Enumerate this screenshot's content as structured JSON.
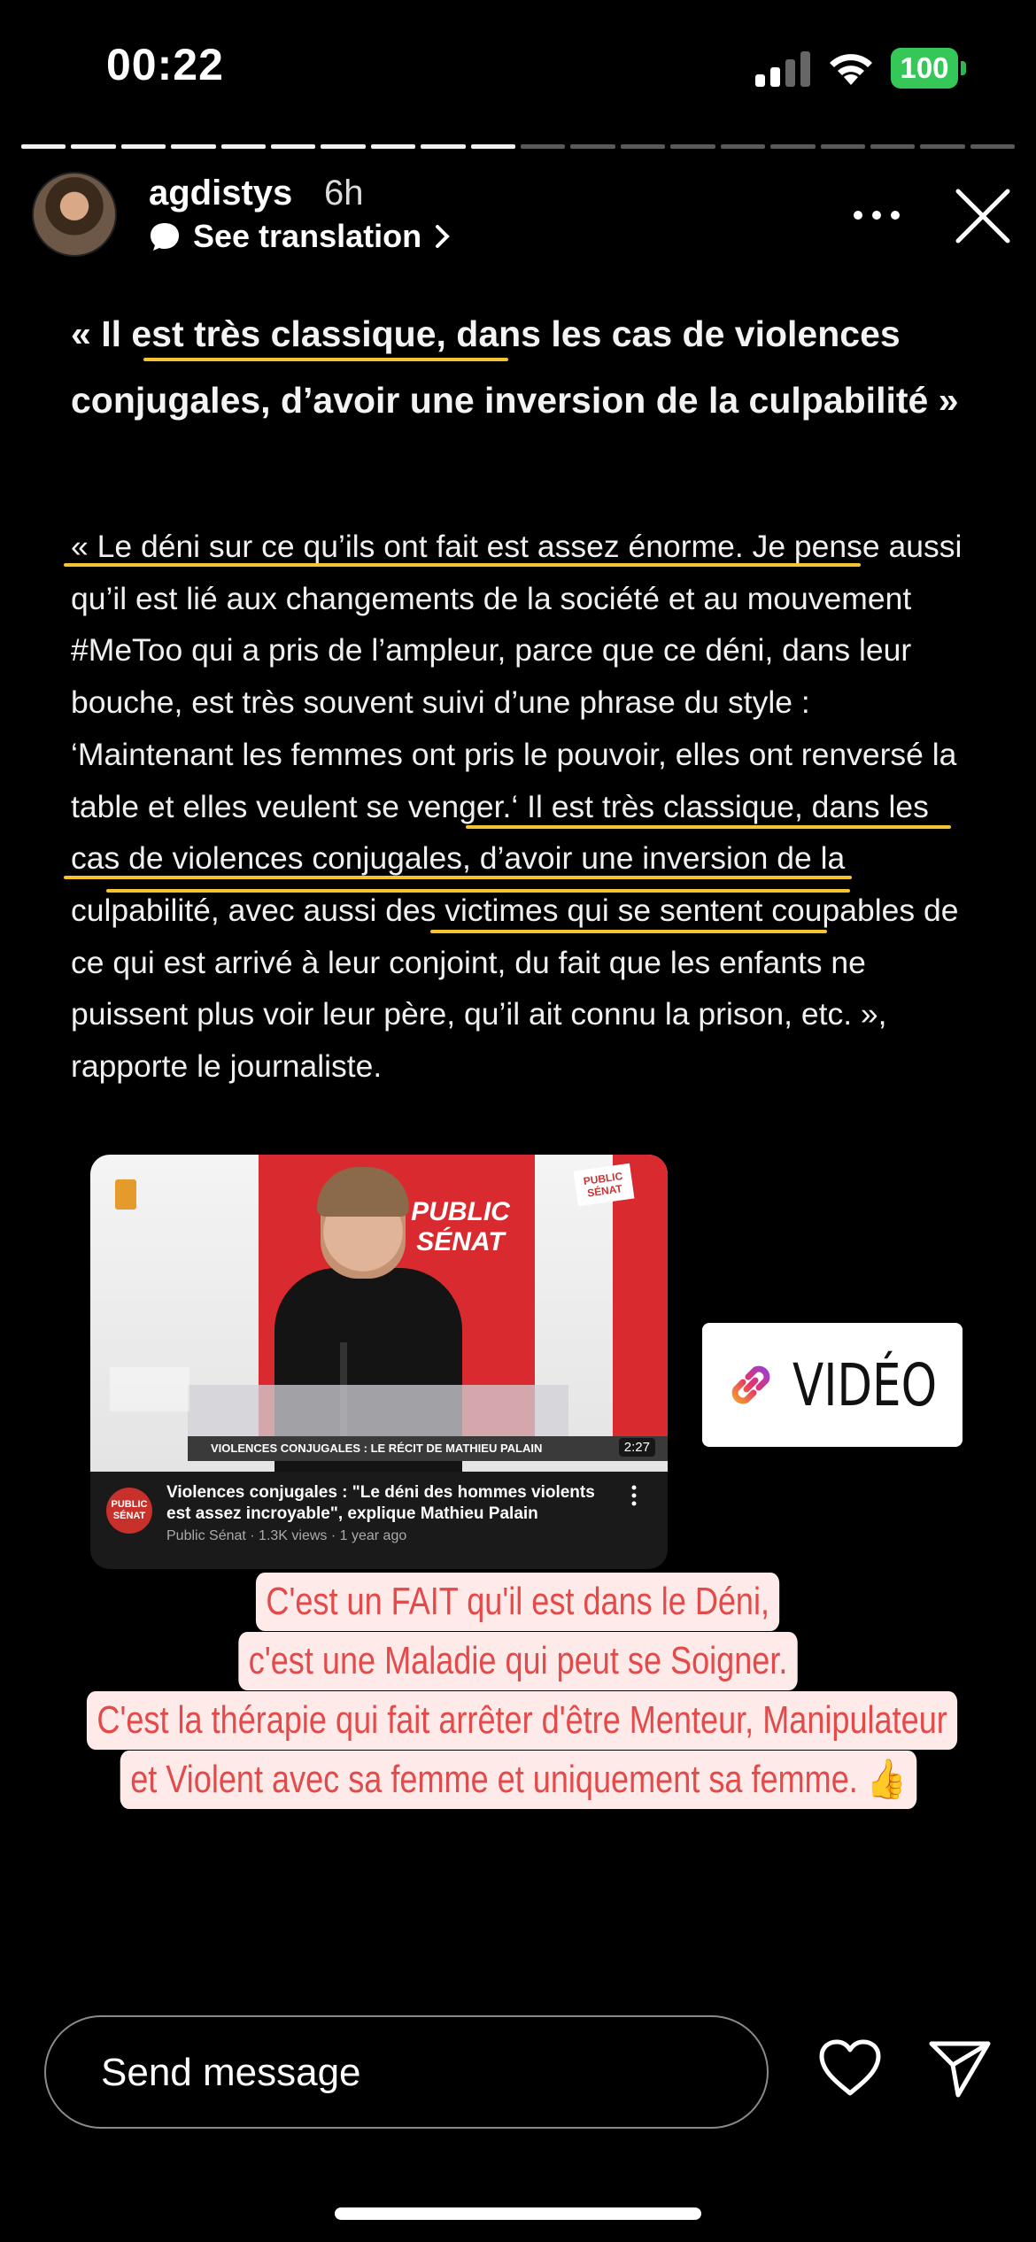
{
  "status_bar": {
    "time": "00:22",
    "battery": "100"
  },
  "progress": {
    "segments_total": 20,
    "segments_done": 10
  },
  "story_header": {
    "username": "agdistys",
    "time_ago": "6h",
    "translate_label": "See translation"
  },
  "article": {
    "headline": "« Il est très classique, dans les cas de violences conjugales, d’avoir une inversion de la culpabilité »",
    "body": "« Le déni sur ce qu’ils ont fait est assez énorme. Je pense aussi qu’il est lié aux changements de la société et au mouvement #MeToo qui a pris de l’ampleur, parce que ce déni, dans leur bouche, est très souvent suivi d’une phrase du style : ‘Maintenant les femmes ont pris le pouvoir, elles ont renversé la table et elles veulent se venger.‘ Il est très classique, dans les cas de violences conjugales, d’avoir une inversion de la culpabilité, avec aussi des victimes qui se sentent coupables de ce qui est arrivé à leur conjoint, du fait que les enfants ne puissent plus voir leur père, qu’il ait connu la prison, etc. », rapporte le journaliste."
  },
  "video_card": {
    "logo_text": "PUBLIC SÉNAT",
    "lower_third": "VIOLENCES CONJUGALES : LE RÉCIT DE MATHIEU PALAIN",
    "duration": "2:27",
    "title": "Violences conjugales : \"Le déni des hommes violents est assez incroyable\", explique Mathieu Palain",
    "meta": "Public Sénat · 1.3K views · 1 year ago",
    "channel_avatar_text": "PUBLIC SÉNAT"
  },
  "link_sticker": {
    "label": "VIDÉO"
  },
  "caption": {
    "lines": [
      "C'est un FAIT qu'il est dans le Déni,",
      "c'est une Maladie qui peut se Soigner.",
      "C'est la thérapie qui fait arrêter d'être Menteur, Manipulateur",
      "et Violent avec sa femme et uniquement sa femme. 👍"
    ],
    "text_color": "#e34a4a",
    "background_color": "#ffeaea"
  },
  "reply_bar": {
    "placeholder": "Send message"
  },
  "colors": {
    "highlight": "#f5c431",
    "battery": "#36c759"
  }
}
